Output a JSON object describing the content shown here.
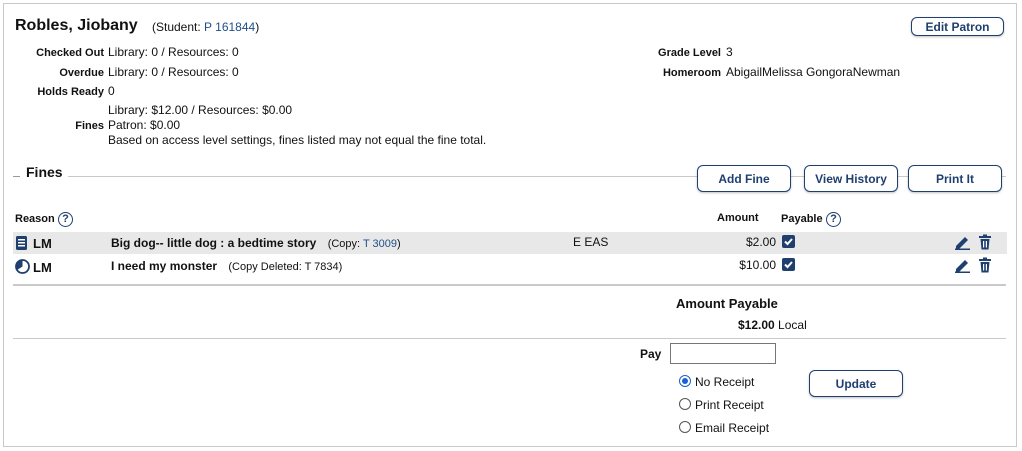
{
  "patron": {
    "name": "Robles, Jiobany",
    "student_prefix": "(Student: ",
    "student_id": "P 161844",
    "student_suffix": ")",
    "edit_button": "Edit Patron"
  },
  "summary": {
    "checked_out_label": "Checked Out",
    "checked_out_value": "Library: 0 / Resources: 0",
    "overdue_label": "Overdue",
    "overdue_value": "Library: 0 / Resources: 0",
    "holds_label": "Holds Ready",
    "holds_value": "0",
    "fines_label": "Fines",
    "fines_line1": "Library: $12.00 / Resources: $0.00",
    "fines_line2": "Patron: $0.00",
    "fines_line3": "Based on access level settings, fines listed may not equal the fine total.",
    "grade_label": "Grade Level",
    "grade_value": "3",
    "homeroom_label": "Homeroom",
    "homeroom_value": "AbigailMelissa GongoraNewman"
  },
  "fines_section": {
    "title": "Fines",
    "add_fine": "Add Fine",
    "view_history": "View History",
    "print_it": "Print It",
    "col_reason": "Reason",
    "col_amount": "Amount",
    "col_payable": "Payable",
    "rows": [
      {
        "icon": "book-icon",
        "type": "LM",
        "title": "Big dog-- little dog : a bedtime story",
        "copy_prefix": "(Copy: ",
        "copy_id": "T 3009",
        "copy_suffix": ")",
        "call_number": "E EAS",
        "amount": "$2.00",
        "payable": true
      },
      {
        "icon": "overdue-clock-icon",
        "type": "LM",
        "title": "I need my monster",
        "copy_prefix": "(Copy Deleted: T 7834)",
        "copy_id": "",
        "copy_suffix": "",
        "call_number": "",
        "amount": "$10.00",
        "payable": true
      }
    ]
  },
  "payment": {
    "amount_payable_label": "Amount Payable",
    "amount_payable_value": "$12.00",
    "amount_payable_suffix": "Local",
    "pay_label": "Pay",
    "pay_value": "",
    "receipt_options": [
      "No Receipt",
      "Print Receipt",
      "Email Receipt"
    ],
    "selected_receipt": "No Receipt",
    "update_button": "Update"
  },
  "colors": {
    "accent": "#1f3f6e",
    "link": "#1f4f8b",
    "row_highlight": "#e8e8e8",
    "border": "#c9c9c9"
  }
}
